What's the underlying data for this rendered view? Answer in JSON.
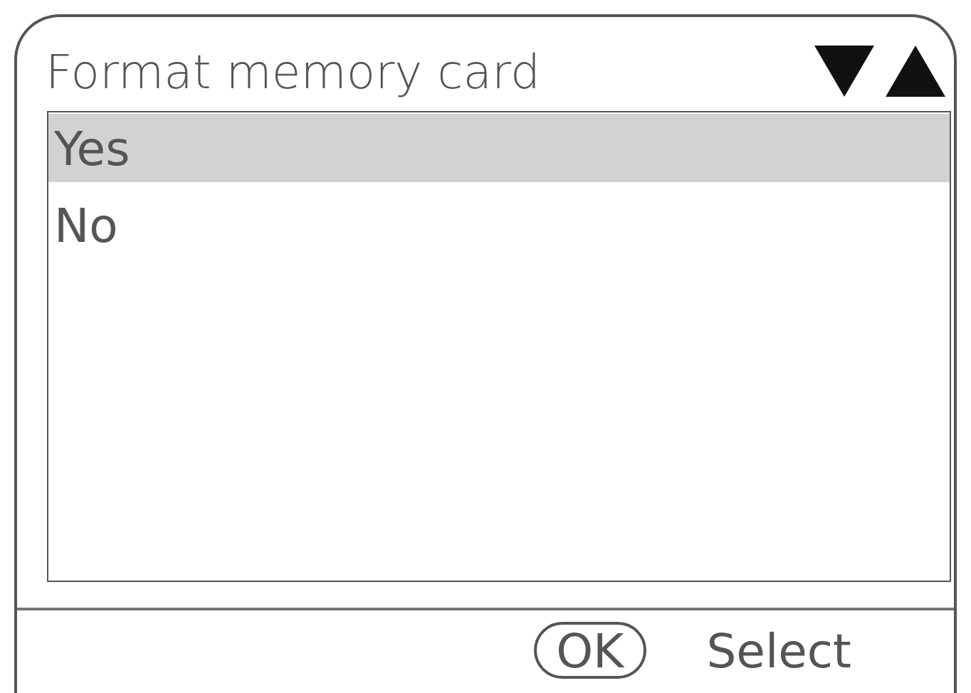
{
  "title": "Format memory card",
  "options": [
    {
      "label": "Yes",
      "selected": true
    },
    {
      "label": "No",
      "selected": false
    }
  ],
  "footer": {
    "button": "OK",
    "action": "Select"
  }
}
